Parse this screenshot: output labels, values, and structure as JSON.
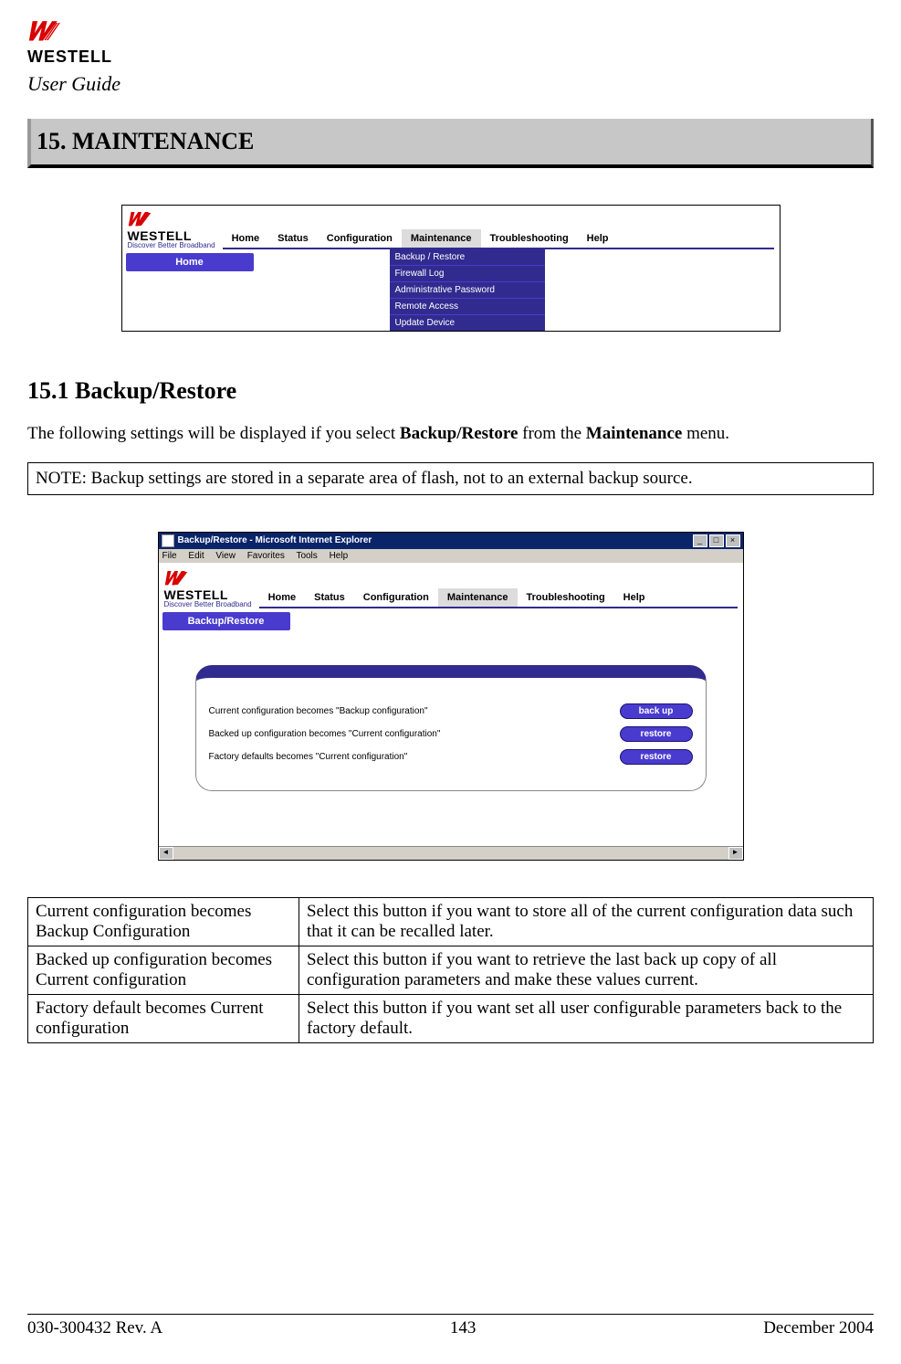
{
  "doc": {
    "user_guide": "User Guide",
    "logo_brand": "WESTELL",
    "section_title": "15.  MAINTENANCE",
    "sub_heading": "15.1 Backup/Restore",
    "intro_text_1": "The following settings will be displayed if you select ",
    "intro_bold_1": "Backup/Restore",
    "intro_text_2": " from the ",
    "intro_bold_2": "Maintenance",
    "intro_text_3": " menu.",
    "note_text": "NOTE: Backup settings are stored in a separate area of flash, not to an external backup source."
  },
  "screenshot1": {
    "logo_brand": "WESTELL",
    "logo_tag": "Discover  Better  Broadband",
    "tabs": [
      "Home",
      "Status",
      "Configuration",
      "Maintenance",
      "Troubleshooting",
      "Help"
    ],
    "side_button": "Home",
    "dropdown": [
      "Backup / Restore",
      "Firewall Log",
      "Administrative Password",
      "Remote Access",
      "Update Device"
    ]
  },
  "browser": {
    "title": "Backup/Restore - Microsoft Internet Explorer",
    "menus": [
      "File",
      "Edit",
      "View",
      "Favorites",
      "Tools",
      "Help"
    ],
    "logo_brand": "WESTELL",
    "logo_tag": "Discover  Better  Broadband",
    "tabs": [
      "Home",
      "Status",
      "Configuration",
      "Maintenance",
      "Troubleshooting",
      "Help"
    ],
    "side_button": "Backup/Restore",
    "rows": [
      {
        "label": "Current configuration becomes \"Backup configuration\"",
        "button": "back up"
      },
      {
        "label": "Backed up configuration becomes \"Current configuration\"",
        "button": "restore"
      },
      {
        "label": "Factory defaults becomes \"Current configuration\"",
        "button": "restore"
      }
    ]
  },
  "definitions": [
    {
      "term": "Current configuration becomes Backup Configuration",
      "desc": "Select this button if you want to store all of the current configuration data such that it can be recalled later."
    },
    {
      "term": "Backed up configuration becomes Current configuration",
      "desc": "Select this button if you want to retrieve the last back up copy of all configuration parameters and make these values current."
    },
    {
      "term": "Factory default becomes Current configuration",
      "desc": "Select this button if you want set all user configurable parameters back to the factory default."
    }
  ],
  "footer": {
    "left": "030-300432 Rev. A",
    "center": "143",
    "right": "December 2004"
  }
}
